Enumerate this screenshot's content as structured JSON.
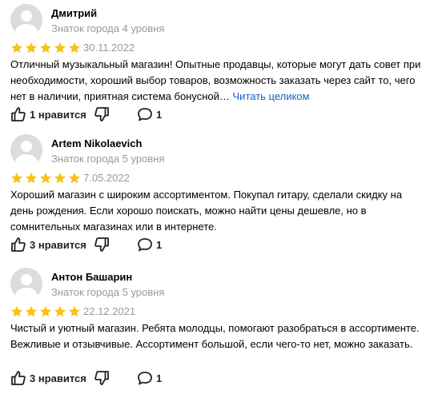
{
  "colors": {
    "star": "#f7c21a",
    "muted": "#999999",
    "link": "#1a5cc8"
  },
  "icons": {
    "avatar": "person-silhouette",
    "rating": "star-icon",
    "like": "thumb-up-icon",
    "dislike": "thumb-down-icon",
    "comment": "comment-bubble-icon"
  },
  "reviews": [
    {
      "author": "Дмитрий",
      "badge": "Знаток города 4 уровня",
      "rating": 5,
      "date": "30.11.2022",
      "text": "Отличный музыкальный магазин! Опытные продавцы, которые могут дать совет при необходимости, хороший выбор товаров, возможность заказать через сайт то, чего нет в наличии, приятная система бонусной…",
      "read_more": "Читать целиком",
      "likes_label": "1 нравится",
      "comments": "1"
    },
    {
      "author": "Artem Nikolaevich",
      "badge": "Знаток города 5 уровня",
      "rating": 5,
      "date": "7.05.2022",
      "text": "Хороший магазин с широким ассортиментом. Покупал гитару, сделали скидку на день рождения. Если хорошо поискать, можно найти цены дешевле, но в сомнительных магазинах или в интернете.",
      "read_more": "",
      "likes_label": "3 нравится",
      "comments": "1"
    },
    {
      "author": "Антон Башарин",
      "badge": "Знаток города 5 уровня",
      "rating": 5,
      "date": "22.12.2021",
      "text": "Чистый и уютный магазин. Ребята молодцы, помогают разобраться в ассортименте. Вежливые и отзывчивые. Ассортимент большой, если чего-то нет, можно заказать.",
      "read_more": "",
      "likes_label": "3 нравится",
      "comments": "1"
    }
  ]
}
